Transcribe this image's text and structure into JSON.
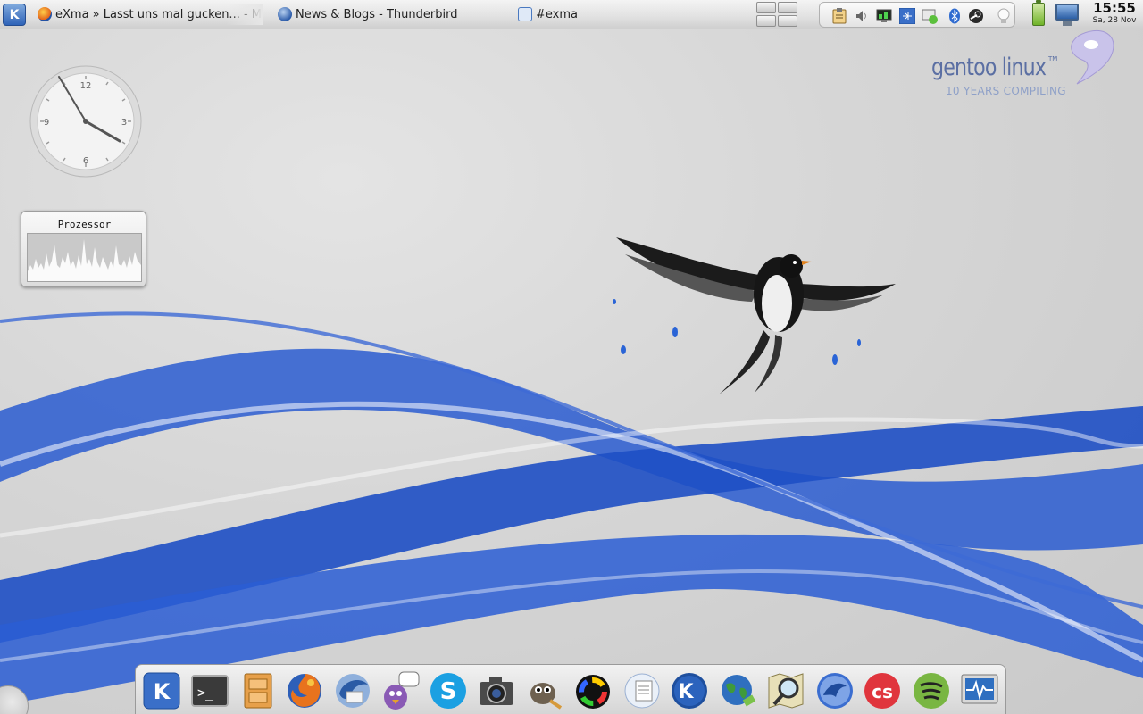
{
  "taskbar": {
    "tasks": [
      {
        "label": "eXma » Lasst uns mal gucken... - Moz",
        "icon": "firefox-icon"
      },
      {
        "label": "News & Blogs - Thunderbird",
        "icon": "thunderbird-icon"
      },
      {
        "label": "#exma",
        "icon": "chat-window-icon"
      }
    ]
  },
  "clock": {
    "time": "15:55",
    "date": "Sa, 28 Nov"
  },
  "systray": {
    "icons": [
      "clipboard-icon",
      "volume-icon",
      "network-monitor-icon",
      "usb-device-icon",
      "network-connection-icon",
      "bluetooth-icon",
      "steam-icon",
      "lightbulb-icon"
    ]
  },
  "branding": {
    "name": "gentoo linux",
    "tm": "TM",
    "tagline": "10 YEARS COMPILING"
  },
  "analog_clock": {
    "labels": [
      "12",
      "3",
      "6",
      "9"
    ]
  },
  "cpu_widget": {
    "title": "Prozessor"
  },
  "dock": {
    "items": [
      {
        "name": "kde-menu",
        "icon": "kde-logo-icon"
      },
      {
        "name": "terminal",
        "icon": "terminal-icon"
      },
      {
        "name": "file-manager",
        "icon": "file-cabinet-icon"
      },
      {
        "name": "firefox",
        "icon": "firefox-icon"
      },
      {
        "name": "thunderbird",
        "icon": "thunderbird-icon"
      },
      {
        "name": "pidgin",
        "icon": "pidgin-icon"
      },
      {
        "name": "skype",
        "icon": "skype-icon"
      },
      {
        "name": "camera",
        "icon": "camera-icon"
      },
      {
        "name": "gimp",
        "icon": "gimp-icon"
      },
      {
        "name": "color-picker",
        "icon": "color-wheel-icon"
      },
      {
        "name": "openoffice",
        "icon": "openoffice-icon"
      },
      {
        "name": "kile",
        "icon": "kile-icon"
      },
      {
        "name": "globe",
        "icon": "globe-icon"
      },
      {
        "name": "map-search",
        "icon": "map-magnifier-icon"
      },
      {
        "name": "dolphin",
        "icon": "dolphin-icon"
      },
      {
        "name": "lastfm",
        "icon": "lastfm-icon"
      },
      {
        "name": "spotify",
        "icon": "spotify-icon"
      },
      {
        "name": "system-monitor",
        "icon": "system-monitor-icon"
      }
    ]
  }
}
